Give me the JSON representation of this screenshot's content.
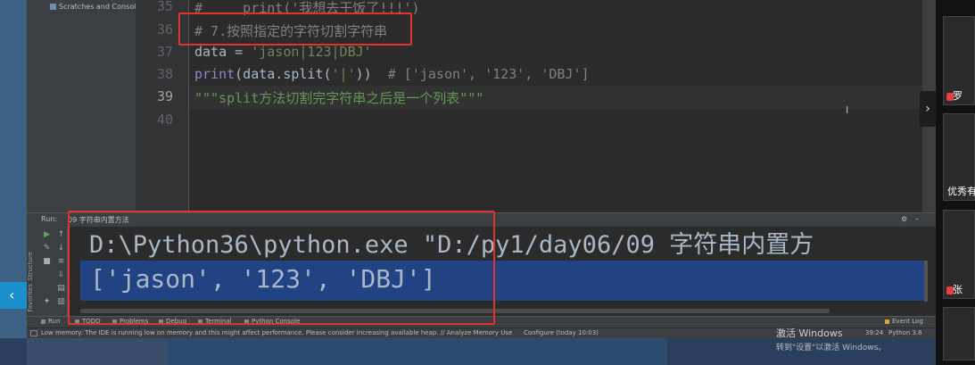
{
  "project": {
    "scratches_label": "Scratches and Consoles"
  },
  "editor": {
    "line_numbers": [
      "35",
      "36",
      "37",
      "38",
      "39",
      "40"
    ],
    "line35": {
      "comment": "#     print('我想去干饭了!!!')"
    },
    "line36": {
      "comment": "# 7.按照指定的字符切割字符串"
    },
    "line37": {
      "prefix": "data = ",
      "string": "'jason|123|DBJ'"
    },
    "line38": {
      "func": "print",
      "open": "(data.split(",
      "arg": "'|'",
      "close": "))",
      "comment": "  # ['jason', '123', 'DBJ']"
    },
    "line39": {
      "docstring": "\"\"\"split方法切割完字符串之后是一个列表\"\"\""
    }
  },
  "run": {
    "label": "Run:",
    "config_tab": "09 字符串内置方法",
    "command": "D:\\Python36\\python.exe \"D:/py1/day06/09 字符串内置方",
    "output": "['jason', '123', 'DBJ']"
  },
  "tool_tabs": {
    "run": "Run",
    "todo": "TODO",
    "problems": "Problems",
    "debug": "Debug",
    "terminal": "Terminal",
    "python_console": "Python Console",
    "event_log": "Event Log"
  },
  "status": {
    "message": "Low memory: The IDE is running low on memory and this might affect performance. Please consider increasing available heap. // Analyze Memory Use",
    "configure": "Configure (today 10:03)",
    "position": "39:24",
    "interpreter": "Python 3.6"
  },
  "side_labels": {
    "structure": "Structure",
    "favorites": "Favorites"
  },
  "windows_activation": {
    "title": "激活 Windows",
    "subtitle": "转到\"设置\"以激活 Windows。"
  },
  "participants": [
    "罗",
    "优秀有",
    "张"
  ],
  "colors": {
    "annotation_red": "#e53030",
    "selection_blue": "#214283",
    "string_green": "#6a8759",
    "comment_gray": "#808080"
  }
}
